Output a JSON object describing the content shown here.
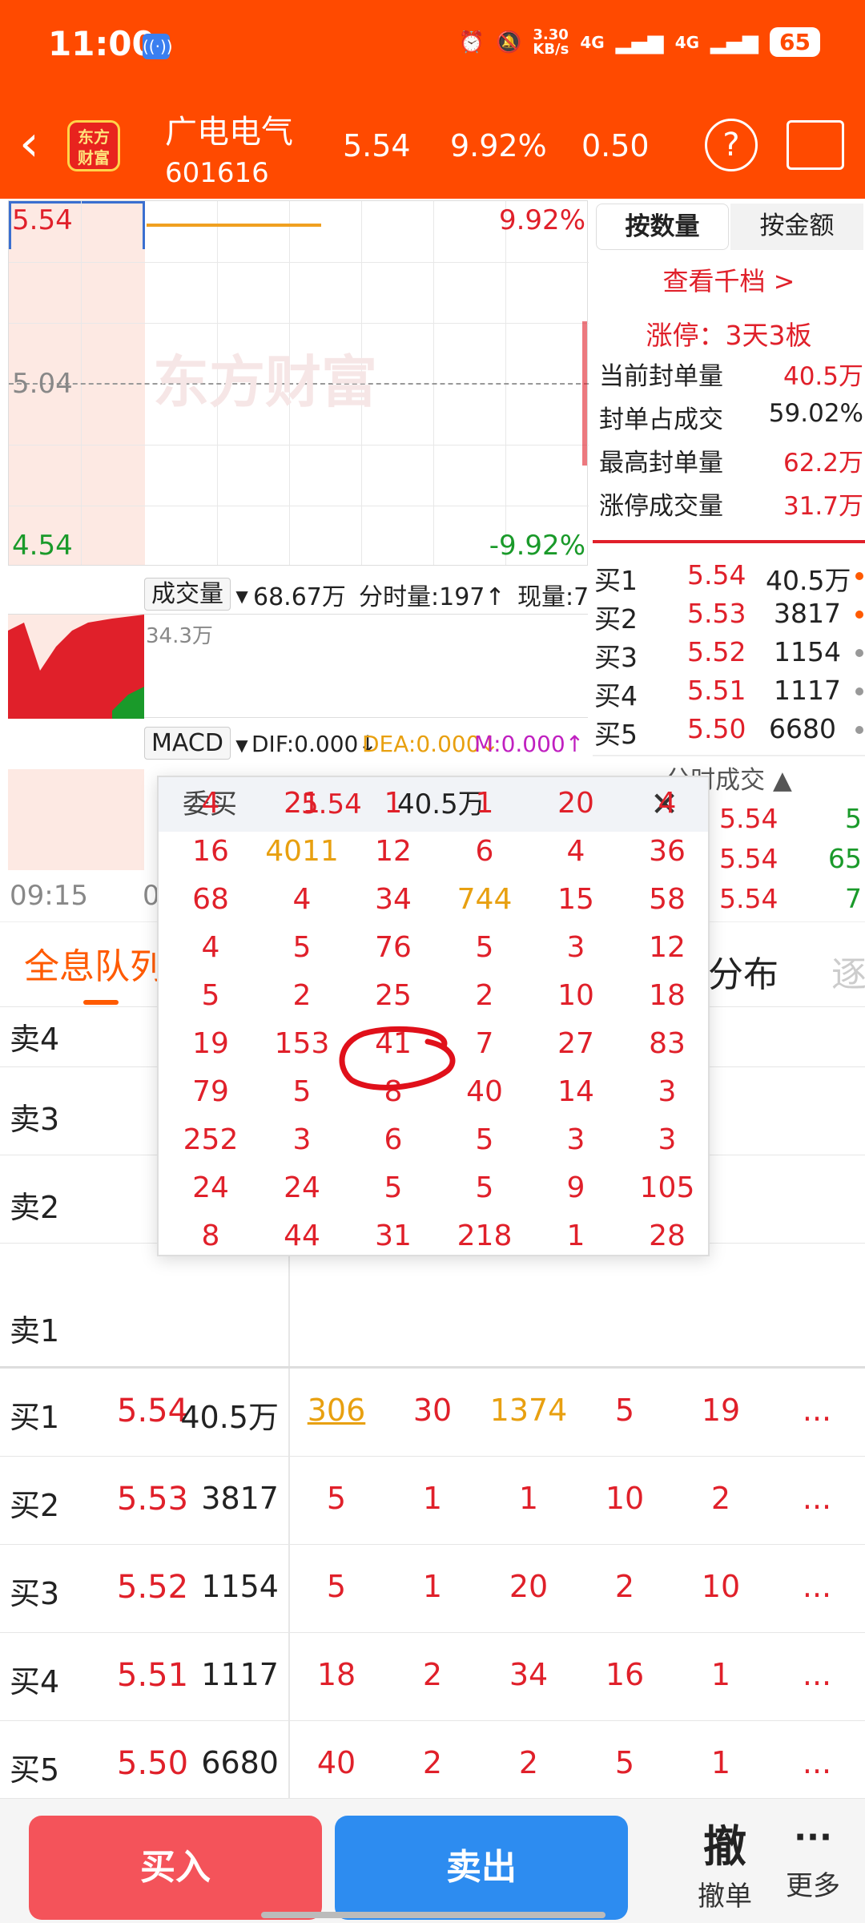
{
  "status_bar": {
    "time": "11:00",
    "speed": "3.30\nKB/s",
    "net1": "4G",
    "net2": "4G",
    "battery": "65"
  },
  "header": {
    "logo": "东方\n财富",
    "name": "广电电气",
    "code": "601616",
    "price": "5.54",
    "pct": "9.92%",
    "change": "0.50",
    "help": "?"
  },
  "chart": {
    "top_price": "5.54",
    "mid_price": "5.04",
    "bottom_price": "4.54",
    "top_pct": "9.92%",
    "bottom_pct": "-9.92%",
    "watermark": "东方财富",
    "time_start": "09:15",
    "time_partial": "0"
  },
  "volume": {
    "selector": "成交量",
    "total": "68.67万",
    "fenshi": "分时量:197↑",
    "now": "现量:7",
    "axis": "34.3万"
  },
  "macd": {
    "selector": "MACD",
    "dif": "DIF:0.000↓",
    "dea": "DEA:0.000↓",
    "m": "M:0.000↑"
  },
  "right_panel": {
    "tab_qty": "按数量",
    "tab_amt": "按金额",
    "level2_link": "查看千档 >",
    "limit_title": "涨停：3天3板",
    "stats": [
      {
        "label": "当前封单量",
        "value": "40.5万"
      },
      {
        "label": "封单占成交",
        "value": "59.02%"
      },
      {
        "label": "最高封单量",
        "value": "62.2万"
      },
      {
        "label": "涨停成交量",
        "value": "31.7万"
      }
    ],
    "bids": [
      {
        "label": "买1",
        "price": "5.54",
        "qty": "40.5万",
        "dot": "#ff5a00"
      },
      {
        "label": "买2",
        "price": "5.53",
        "qty": "3817",
        "dot": "#ff5a00"
      },
      {
        "label": "买3",
        "price": "5.52",
        "qty": "1154",
        "dot": "#999"
      },
      {
        "label": "买4",
        "price": "5.51",
        "qty": "1117",
        "dot": "#999"
      },
      {
        "label": "买5",
        "price": "5.50",
        "qty": "6680",
        "dot": "#999"
      }
    ],
    "ticks_title": "分时成交 ▲",
    "ticks": [
      {
        "price": "5.54",
        "vol": "5"
      },
      {
        "price": "5.54",
        "vol": "65"
      },
      {
        "price": "5.54",
        "vol": "7"
      }
    ]
  },
  "tabs": {
    "main": "全息队列",
    "right": "分布",
    "edge": "逐"
  },
  "asks": [
    {
      "label": "卖4"
    },
    {
      "label": "卖3"
    },
    {
      "label": "卖2"
    },
    {
      "label": "卖1"
    }
  ],
  "bid_rows": [
    {
      "label": "买1",
      "price": "5.54",
      "qty": "40.5万",
      "cells": [
        "306",
        "30",
        "1374",
        "5",
        "19"
      ],
      "more": "..."
    },
    {
      "label": "买2",
      "price": "5.53",
      "qty": "3817",
      "cells": [
        "5",
        "1",
        "1",
        "10",
        "2"
      ],
      "more": "..."
    },
    {
      "label": "买3",
      "price": "5.52",
      "qty": "1154",
      "cells": [
        "5",
        "1",
        "20",
        "2",
        "10"
      ],
      "more": "..."
    },
    {
      "label": "买4",
      "price": "5.51",
      "qty": "1117",
      "cells": [
        "18",
        "2",
        "34",
        "16",
        "1"
      ],
      "more": "..."
    },
    {
      "label": "买5",
      "price": "5.50",
      "qty": "6680",
      "cells": [
        "40",
        "2",
        "2",
        "5",
        "1"
      ],
      "more": "..."
    }
  ],
  "popup": {
    "title": "委买",
    "price": "5.54",
    "qty": "40.5万",
    "close": "✕",
    "rows": [
      [
        "4",
        "21",
        "1",
        "1",
        "20",
        "4"
      ],
      [
        "16",
        "4011",
        "12",
        "6",
        "4",
        "36"
      ],
      [
        "68",
        "4",
        "34",
        "744",
        "15",
        "58"
      ],
      [
        "4",
        "5",
        "76",
        "5",
        "3",
        "12"
      ],
      [
        "5",
        "2",
        "25",
        "2",
        "10",
        "18"
      ],
      [
        "19",
        "153",
        "41",
        "7",
        "27",
        "83"
      ],
      [
        "79",
        "5",
        "8",
        "40",
        "14",
        "3"
      ],
      [
        "252",
        "3",
        "6",
        "5",
        "3",
        "3"
      ],
      [
        "24",
        "24",
        "5",
        "5",
        "9",
        "105"
      ],
      [
        "8",
        "44",
        "31",
        "218",
        "1",
        "28"
      ]
    ]
  },
  "bottom": {
    "buy": "买入",
    "sell": "卖出",
    "cancel_icon": "撤",
    "cancel": "撤单",
    "more_icon": "···",
    "more": "更多"
  }
}
